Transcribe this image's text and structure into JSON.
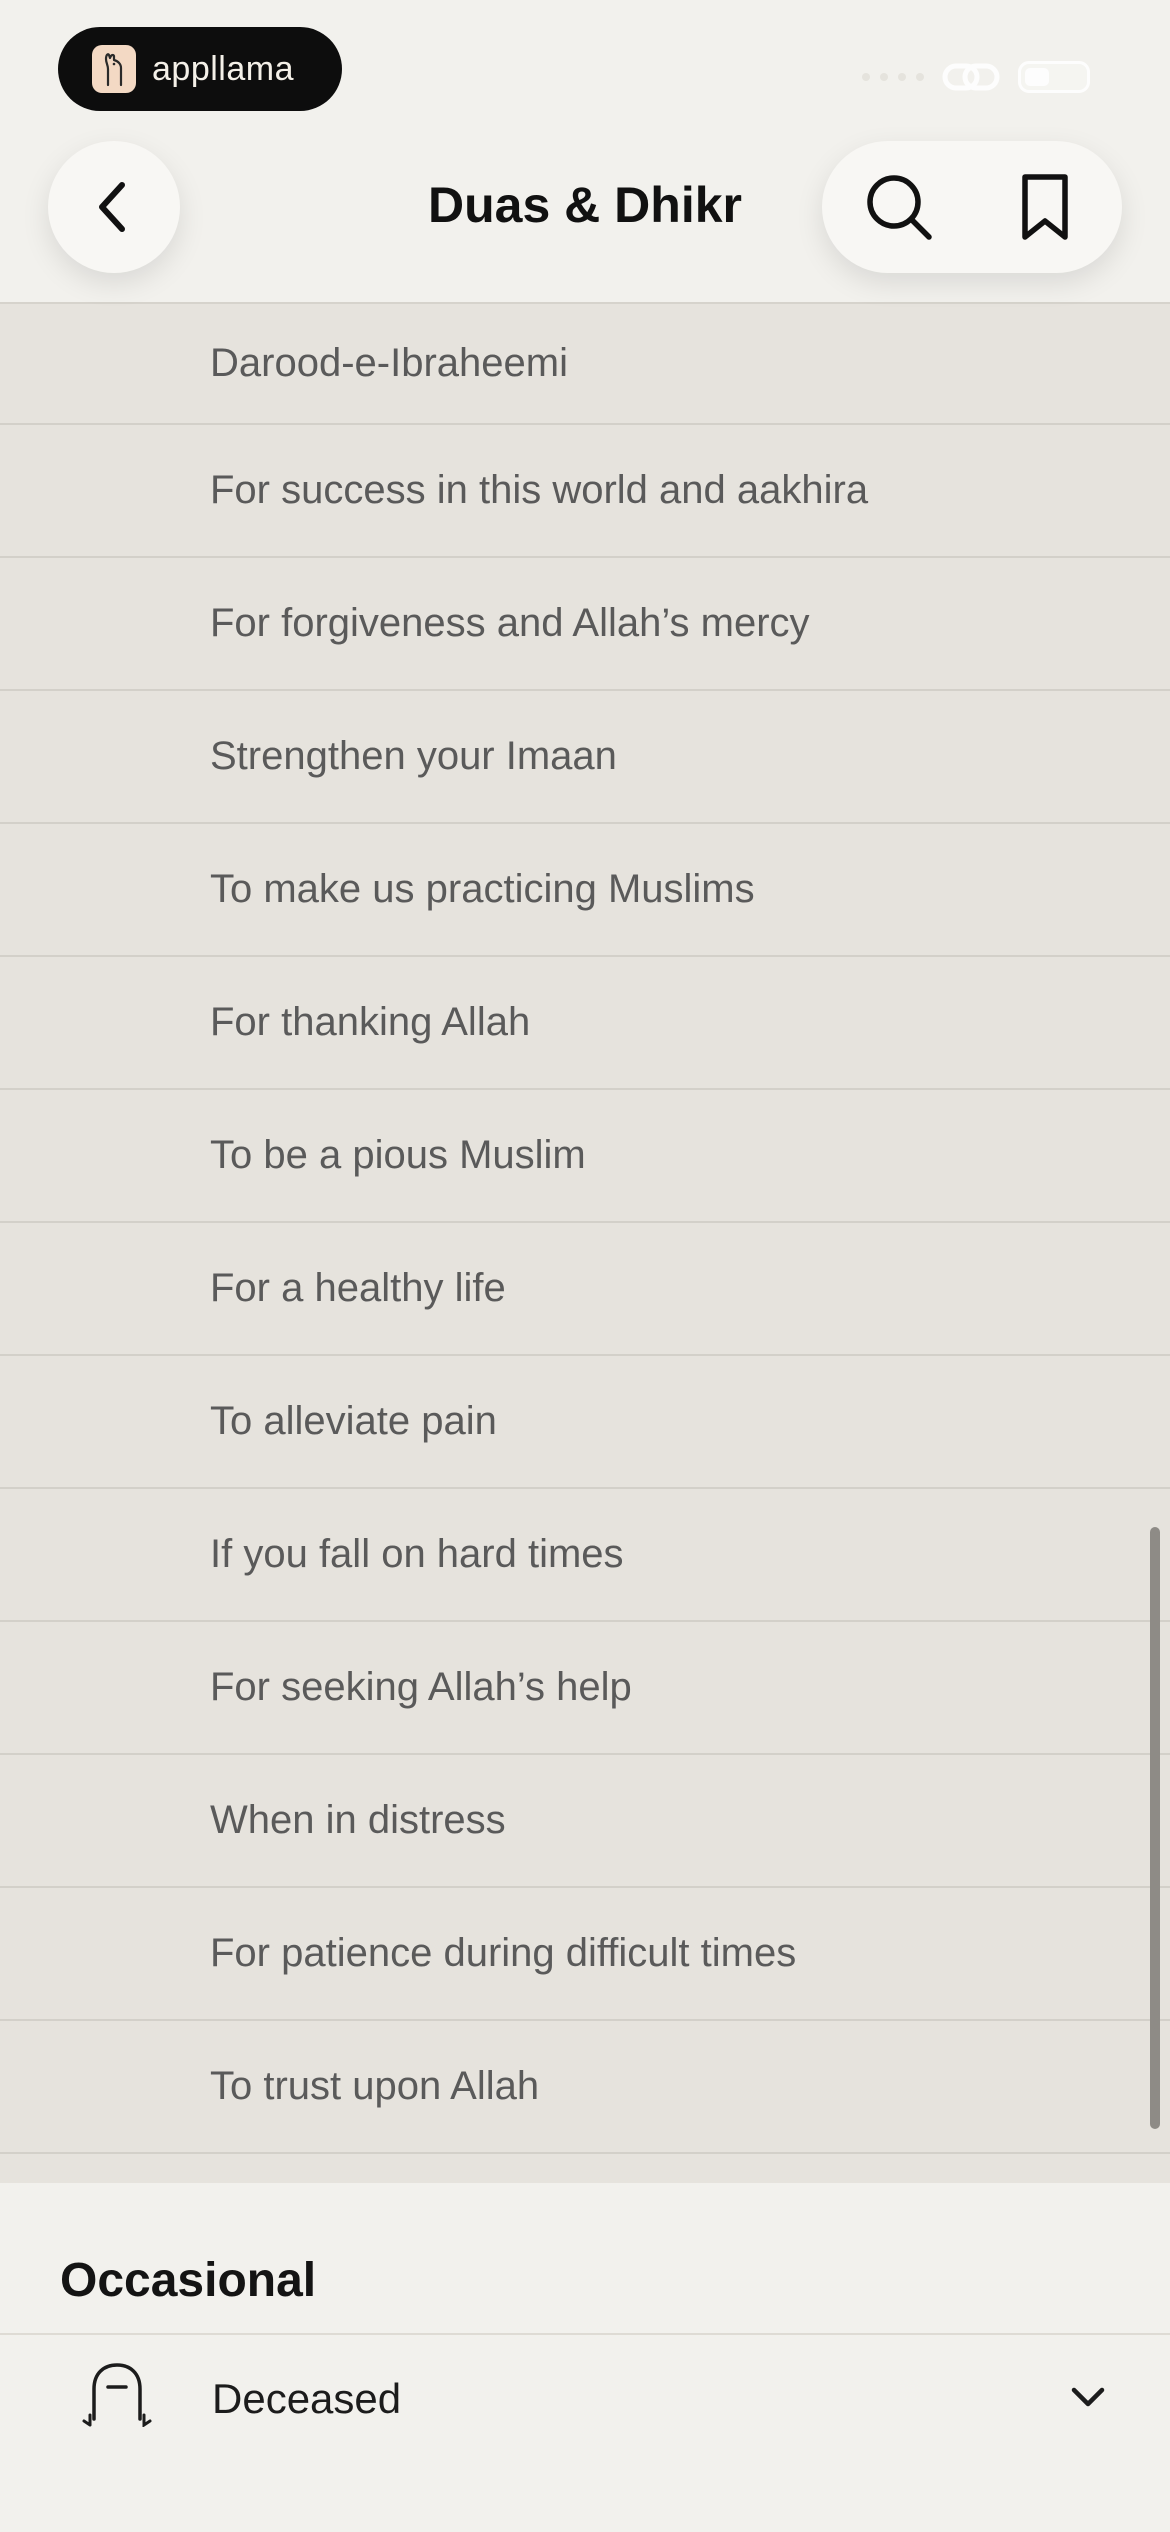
{
  "brand": {
    "name": "appllama",
    "logo_icon": "llama-logo-icon"
  },
  "header": {
    "title": "Duas & Dhikr",
    "back_icon": "chevron-left-icon",
    "search_icon": "search-icon",
    "bookmark_icon": "bookmark-icon"
  },
  "list": {
    "items": [
      "Darood-e-Ibraheemi",
      "For success in this world and aakhira",
      "For forgiveness and Allah’s mercy",
      "Strengthen your Imaan",
      "To make us practicing Muslims",
      "For thanking Allah",
      "To be a pious Muslim",
      "For a healthy life",
      "To alleviate pain",
      "If you fall on hard times",
      "For seeking Allah’s help",
      "When in distress",
      "For patience during difficult times",
      "To trust upon Allah"
    ]
  },
  "occasional": {
    "title": "Occasional",
    "row": {
      "label": "Deceased",
      "icon": "grave-icon",
      "chevron": "chevron-down-icon"
    }
  },
  "colors": {
    "background": "#f2f1ed",
    "list_background": "#e6e3dd",
    "list_text": "#5a5a5a",
    "brand_pill": "#0d0d0d"
  }
}
